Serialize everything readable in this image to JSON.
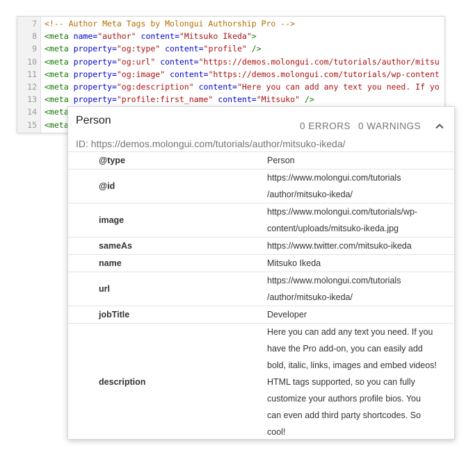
{
  "code": {
    "lines": [
      {
        "num": "7",
        "parts": [
          {
            "c": "comment",
            "t": "<!-- Author Meta Tags by Molongui Authorship Pro -->"
          }
        ]
      },
      {
        "num": "8",
        "parts": [
          {
            "c": "tag",
            "t": "<meta"
          },
          {
            "c": "plain",
            "t": " "
          },
          {
            "c": "attr",
            "t": "name="
          },
          {
            "c": "val",
            "t": "\"author\""
          },
          {
            "c": "plain",
            "t": " "
          },
          {
            "c": "attr",
            "t": "content="
          },
          {
            "c": "val",
            "t": "\"Mitsuko Ikeda\""
          },
          {
            "c": "tag",
            "t": ">"
          }
        ]
      },
      {
        "num": "9",
        "parts": [
          {
            "c": "tag",
            "t": "<meta"
          },
          {
            "c": "plain",
            "t": " "
          },
          {
            "c": "attr",
            "t": "property="
          },
          {
            "c": "val",
            "t": "\"og:type\""
          },
          {
            "c": "plain",
            "t": " "
          },
          {
            "c": "attr",
            "t": "content="
          },
          {
            "c": "val",
            "t": "\"profile\""
          },
          {
            "c": "plain",
            "t": " "
          },
          {
            "c": "tag",
            "t": "/>"
          }
        ]
      },
      {
        "num": "10",
        "parts": [
          {
            "c": "tag",
            "t": "<meta"
          },
          {
            "c": "plain",
            "t": " "
          },
          {
            "c": "attr",
            "t": "property="
          },
          {
            "c": "val",
            "t": "\"og:url\""
          },
          {
            "c": "plain",
            "t": " "
          },
          {
            "c": "attr",
            "t": "content="
          },
          {
            "c": "val",
            "t": "\"https://demos.molongui.com/tutorials/author/mitsu"
          }
        ]
      },
      {
        "num": "11",
        "parts": [
          {
            "c": "tag",
            "t": "<meta"
          },
          {
            "c": "plain",
            "t": " "
          },
          {
            "c": "attr",
            "t": "property="
          },
          {
            "c": "val",
            "t": "\"og:image\""
          },
          {
            "c": "plain",
            "t": " "
          },
          {
            "c": "attr",
            "t": "content="
          },
          {
            "c": "val",
            "t": "\"https://demos.molongui.com/tutorials/wp-content"
          }
        ]
      },
      {
        "num": "12",
        "parts": [
          {
            "c": "tag",
            "t": "<meta"
          },
          {
            "c": "plain",
            "t": " "
          },
          {
            "c": "attr",
            "t": "property="
          },
          {
            "c": "val",
            "t": "\"og:description\""
          },
          {
            "c": "plain",
            "t": " "
          },
          {
            "c": "attr",
            "t": "content="
          },
          {
            "c": "val",
            "t": "\"Here you can add any text you need. If yo"
          }
        ]
      },
      {
        "num": "13",
        "parts": [
          {
            "c": "tag",
            "t": "<meta"
          },
          {
            "c": "plain",
            "t": " "
          },
          {
            "c": "attr",
            "t": "property="
          },
          {
            "c": "val",
            "t": "\"profile:first_name\""
          },
          {
            "c": "plain",
            "t": " "
          },
          {
            "c": "attr",
            "t": "content="
          },
          {
            "c": "val",
            "t": "\"Mitsuko\""
          },
          {
            "c": "plain",
            "t": " "
          },
          {
            "c": "tag",
            "t": "/>"
          }
        ]
      },
      {
        "num": "14",
        "parts": [
          {
            "c": "tag",
            "t": "<meta"
          }
        ]
      },
      {
        "num": "15",
        "parts": [
          {
            "c": "tag",
            "t": "<meta"
          }
        ]
      }
    ]
  },
  "card": {
    "title": "Person",
    "errors": "0 ERRORS",
    "warnings": "0 WARNINGS",
    "collapse_icon": "chevron-up-icon",
    "id_text": "ID: https://demos.molongui.com/tutorials/author/mitsuko-ikeda/",
    "rows": [
      {
        "key": "@type",
        "lines": [
          "Person"
        ]
      },
      {
        "key": "@id",
        "lines": [
          "https://www.molongui.com/tutorials",
          "/author/mitsuko-ikeda/"
        ]
      },
      {
        "key": "image",
        "lines": [
          "https://www.molongui.com/tutorials/wp-",
          "content/uploads/mitsuko-ikeda.jpg"
        ]
      },
      {
        "key": "sameAs",
        "lines": [
          "https://www.twitter.com/mitsuko-ikeda"
        ]
      },
      {
        "key": "name",
        "lines": [
          "Mitsuko Ikeda"
        ]
      },
      {
        "key": "url",
        "lines": [
          "https://www.molongui.com/tutorials",
          "/author/mitsuko-ikeda/"
        ]
      },
      {
        "key": "jobTitle",
        "lines": [
          "Developer"
        ]
      },
      {
        "key": "description",
        "lines": [
          "Here you can add any text you need. If you",
          "have the Pro add-on, you can easily add",
          "bold, italic, links, images and embed videos!",
          "HTML tags supported, so you can fully",
          "customize your authors profile bios. You",
          "can even add third party shortcodes. So",
          "cool!"
        ]
      }
    ]
  },
  "colors": {
    "comment": "#b26e00",
    "tag": "#117700",
    "attr": "#0000cc",
    "value": "#aa1111"
  }
}
